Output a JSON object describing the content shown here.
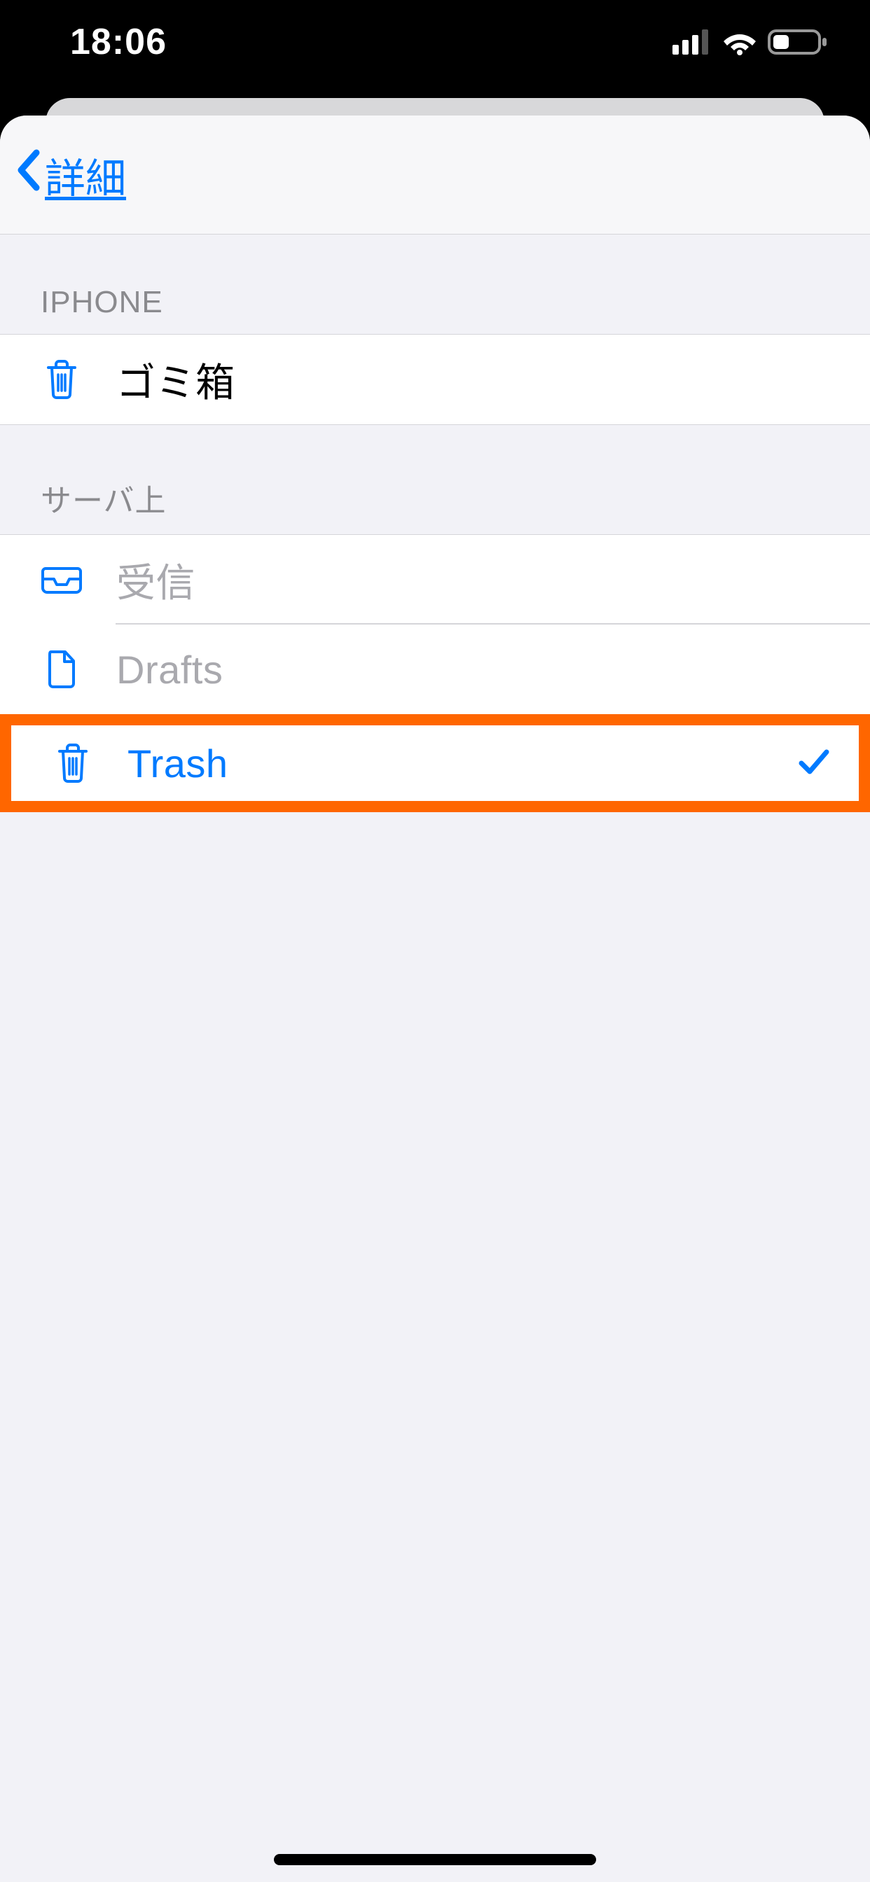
{
  "status": {
    "time": "18:06"
  },
  "nav": {
    "back_label": "詳細"
  },
  "sections": {
    "iphone": {
      "header": "IPHONE",
      "items": [
        {
          "label": "ゴミ箱",
          "icon": "trash"
        }
      ]
    },
    "server": {
      "header": "サーバ上",
      "items": [
        {
          "label": "受信",
          "icon": "inbox",
          "disabled": true
        },
        {
          "label": "Drafts",
          "icon": "document",
          "disabled": true
        },
        {
          "label": "Trash",
          "icon": "trash",
          "selected": true,
          "highlighted": true
        }
      ]
    }
  },
  "colors": {
    "accent": "#007aff",
    "highlight": "#ff6600"
  }
}
